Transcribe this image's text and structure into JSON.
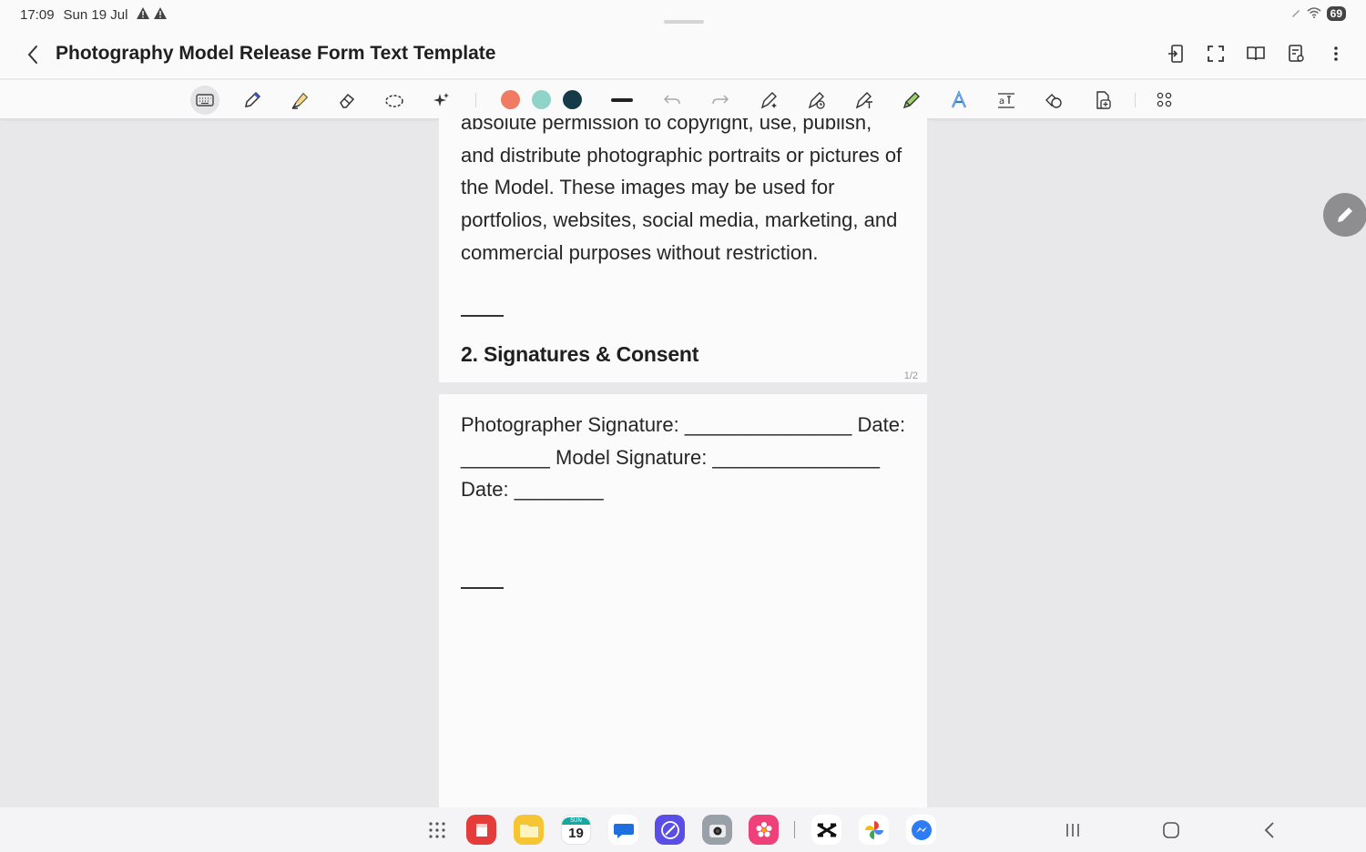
{
  "status_bar": {
    "time": "17:09",
    "date": "Sun 19 Jul",
    "battery": "69"
  },
  "header": {
    "title": "Photography Model Release Form Text Template"
  },
  "toolbar": {
    "colors": [
      "#f07a62",
      "#8fd3c9",
      "#173a48"
    ]
  },
  "document": {
    "page1_text": "absolute permission to copyright, use, publish, and distribute photographic portraits or pictures of the Model. These images may be used for portfolios, websites, social media, marketing, and commercial purposes without restriction.",
    "section_heading": "2. Signatures & Consent",
    "page_indicator": "1/2",
    "page2_text": "Photographer Signature: _______________ Date: ________ Model Signature: _______________ Date: ________"
  },
  "taskbar": {
    "calendar_day": "SUN",
    "calendar_date": "19"
  }
}
